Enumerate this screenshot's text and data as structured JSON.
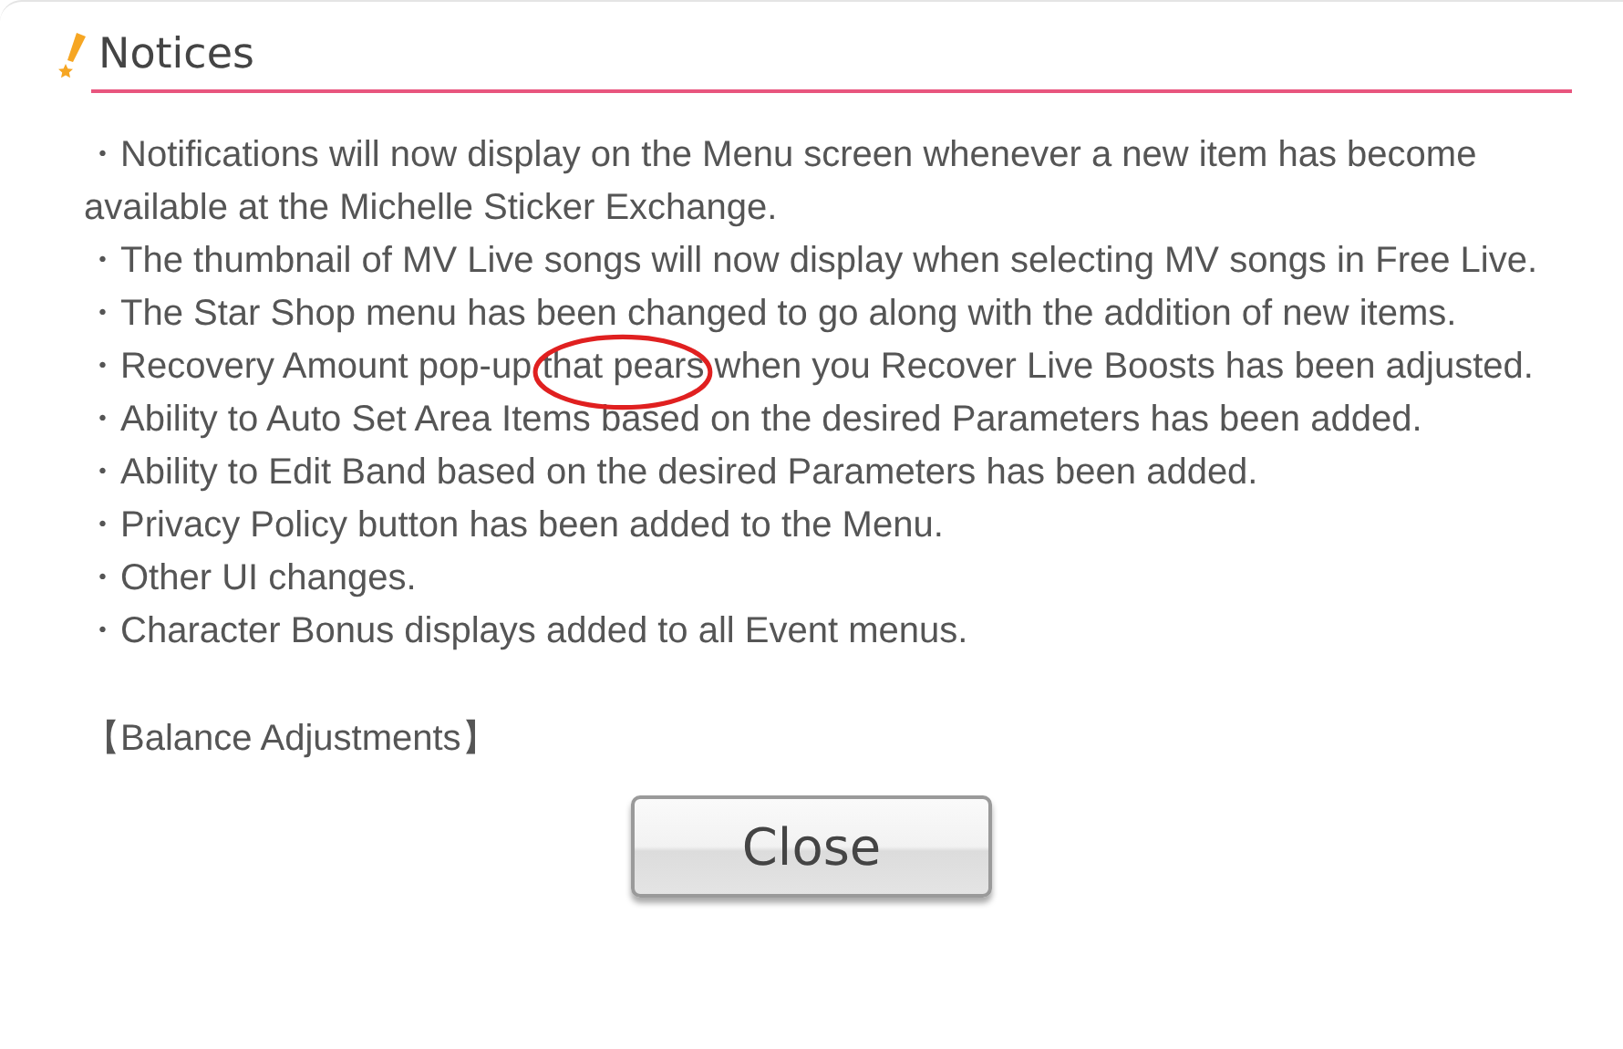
{
  "dialog": {
    "title": "Notices",
    "items": [
      {
        "text": "・Notifications will now display on the Menu screen whenever a new item has become available at the Michelle Sticker Exchange."
      },
      {
        "text": "・The thumbnail of MV Live songs will now display when selecting MV songs in Free Live."
      },
      {
        "text": "・The Star Shop menu has been changed to go along with the addition of new items."
      },
      {
        "text": "・Recovery Amount pop-up ",
        "circled": "that pears",
        "after": " when you Recover Live Boosts has been adjusted."
      },
      {
        "text": "・Ability to Auto Set Area Items based on the desired Parameters has been added."
      },
      {
        "text": "・Ability to Edit Band based on the desired Parameters has been added."
      },
      {
        "text": "・Privacy Policy button has been added to the Menu."
      },
      {
        "text": "・Other UI changes."
      },
      {
        "text": "・Character Bonus displays added to all Event menus."
      }
    ],
    "section": "【Balance Adjustments】",
    "button": "Close"
  }
}
